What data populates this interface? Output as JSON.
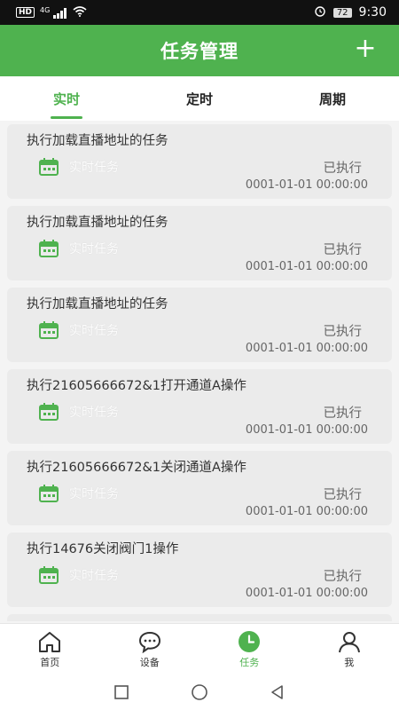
{
  "status_bar": {
    "hd": "HD",
    "network": "4G",
    "battery": "72",
    "time": "9:30"
  },
  "header": {
    "title": "任务管理",
    "add_label": "+"
  },
  "tabs": [
    {
      "label": "实时",
      "active": true
    },
    {
      "label": "定时",
      "active": false
    },
    {
      "label": "周期",
      "active": false
    }
  ],
  "tasks": [
    {
      "title": "执行加载直播地址的任务",
      "type": "实时任务",
      "status": "已执行",
      "time": "0001-01-01 00:00:00"
    },
    {
      "title": "执行加载直播地址的任务",
      "type": "实时任务",
      "status": "已执行",
      "time": "0001-01-01 00:00:00"
    },
    {
      "title": "执行加载直播地址的任务",
      "type": "实时任务",
      "status": "已执行",
      "time": "0001-01-01 00:00:00"
    },
    {
      "title": "执行21605666672&1打开通道A操作",
      "type": "实时任务",
      "status": "已执行",
      "time": "0001-01-01 00:00:00"
    },
    {
      "title": "执行21605666672&1关闭通道A操作",
      "type": "实时任务",
      "status": "已执行",
      "time": "0001-01-01 00:00:00"
    },
    {
      "title": "执行14676关闭阀门1操作",
      "type": "实时任务",
      "status": "已执行",
      "time": "0001-01-01 00:00:00"
    }
  ],
  "bottom_nav": [
    {
      "label": "首页",
      "icon": "home-icon",
      "active": false
    },
    {
      "label": "设备",
      "icon": "chat-icon",
      "active": false
    },
    {
      "label": "任务",
      "icon": "clock-icon",
      "active": true
    },
    {
      "label": "我",
      "icon": "user-icon",
      "active": false
    }
  ],
  "colors": {
    "accent": "#4fb24f",
    "card_bg": "#ebebeb"
  }
}
